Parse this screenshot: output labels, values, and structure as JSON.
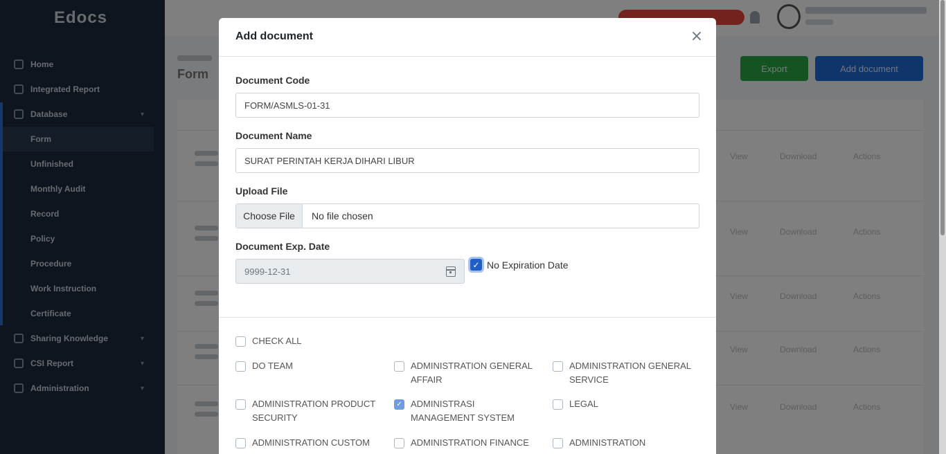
{
  "sidebar": {
    "logo": "Edocs",
    "items": [
      {
        "label": "Home"
      },
      {
        "label": "Integrated Report"
      },
      {
        "label": "Database"
      },
      {
        "label": "Sharing Knowledge"
      },
      {
        "label": "CSI Report"
      },
      {
        "label": "Administration"
      }
    ],
    "database_sub": [
      {
        "label": "Form"
      },
      {
        "label": "Unfinished"
      },
      {
        "label": "Monthly Audit"
      },
      {
        "label": "Record"
      },
      {
        "label": "Policy"
      },
      {
        "label": "Procedure"
      },
      {
        "label": "Work Instruction"
      },
      {
        "label": "Certificate"
      }
    ]
  },
  "page": {
    "title": "Form",
    "export_label": "Export",
    "add_document_label": "Add document",
    "row_links": [
      "View",
      "Download",
      "Actions"
    ]
  },
  "modal": {
    "title": "Add document",
    "close_symbol": "×",
    "doc_code_label": "Document Code",
    "doc_code_value": "FORM/ASMLS-01-31",
    "doc_name_label": "Document Name",
    "doc_name_value": "SURAT PERINTAH KERJA DIHARI LIBUR",
    "upload_label": "Upload File",
    "file_button": "Choose File",
    "file_status": "No file chosen",
    "exp_label": "Document Exp. Date",
    "exp_value": "9999-12-31",
    "no_exp_label": "No Expiration Date",
    "no_exp_checked": true,
    "check_all_label": "CHECK ALL",
    "departments": [
      {
        "label": "DO TEAM",
        "checked": false
      },
      {
        "label": "ADMINISTRATION GENERAL AFFAIR",
        "checked": false
      },
      {
        "label": "ADMINISTRATION GENERAL SERVICE",
        "checked": false
      },
      {
        "label": "ADMINISTRATION PRODUCT SECURITY",
        "checked": false
      },
      {
        "label": "ADMINISTRASI MANAGEMENT SYSTEM",
        "checked": true
      },
      {
        "label": "LEGAL",
        "checked": false
      },
      {
        "label": "ADMINISTRATION CUSTOM",
        "checked": false
      },
      {
        "label": "ADMINISTRATION FINANCE",
        "checked": false
      },
      {
        "label": "ADMINISTRATION",
        "checked": false
      }
    ]
  }
}
